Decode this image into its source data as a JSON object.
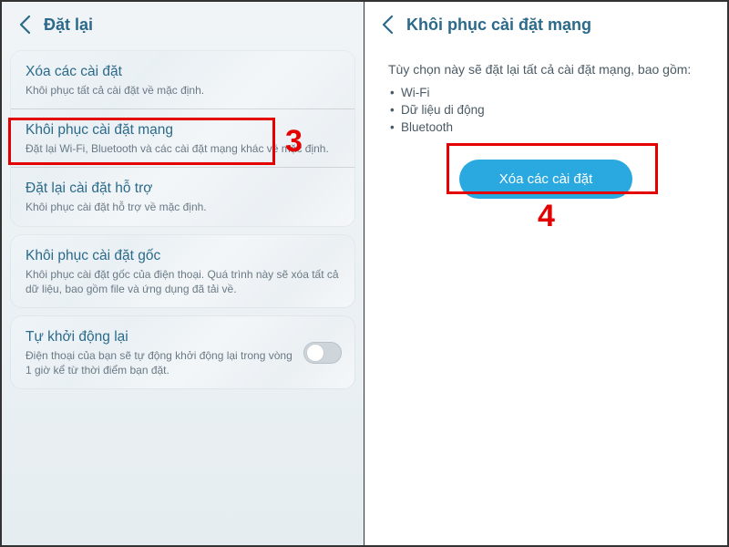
{
  "left": {
    "header": {
      "title": "Đặt lại"
    },
    "groups": [
      {
        "items": [
          {
            "title": "Xóa các cài đặt",
            "desc": "Khôi phục tất cả cài đặt về mặc định."
          },
          {
            "title": "Khôi phục cài đặt mạng",
            "desc": "Đặt lại Wi-Fi, Bluetooth và các cài đặt mạng khác về mặc định."
          },
          {
            "title": "Đặt lại cài đặt hỗ trợ",
            "desc": "Khôi phục cài đặt hỗ trợ về mặc định."
          }
        ]
      },
      {
        "items": [
          {
            "title": "Khôi phục cài đặt gốc",
            "desc": "Khôi phục cài đặt gốc của điện thoại. Quá trình này sẽ xóa tất cả dữ liệu, bao gồm file và ứng dụng đã tải về."
          }
        ]
      },
      {
        "items": [
          {
            "title": "Tự khởi động lại",
            "desc": "Điện thoại của bạn sẽ tự động khởi động lại trong vòng 1 giờ kể từ thời điểm bạn đặt.",
            "toggle": false
          }
        ]
      }
    ],
    "step": "3"
  },
  "right": {
    "header": {
      "title": "Khôi phục cài đặt mạng"
    },
    "intro": "Tùy chọn này sẽ đặt lại tất cả cài đặt mạng, bao gồm:",
    "bullets": [
      "Wi-Fi",
      "Dữ liệu di động",
      "Bluetooth"
    ],
    "action": "Xóa các cài đặt",
    "step": "4"
  }
}
